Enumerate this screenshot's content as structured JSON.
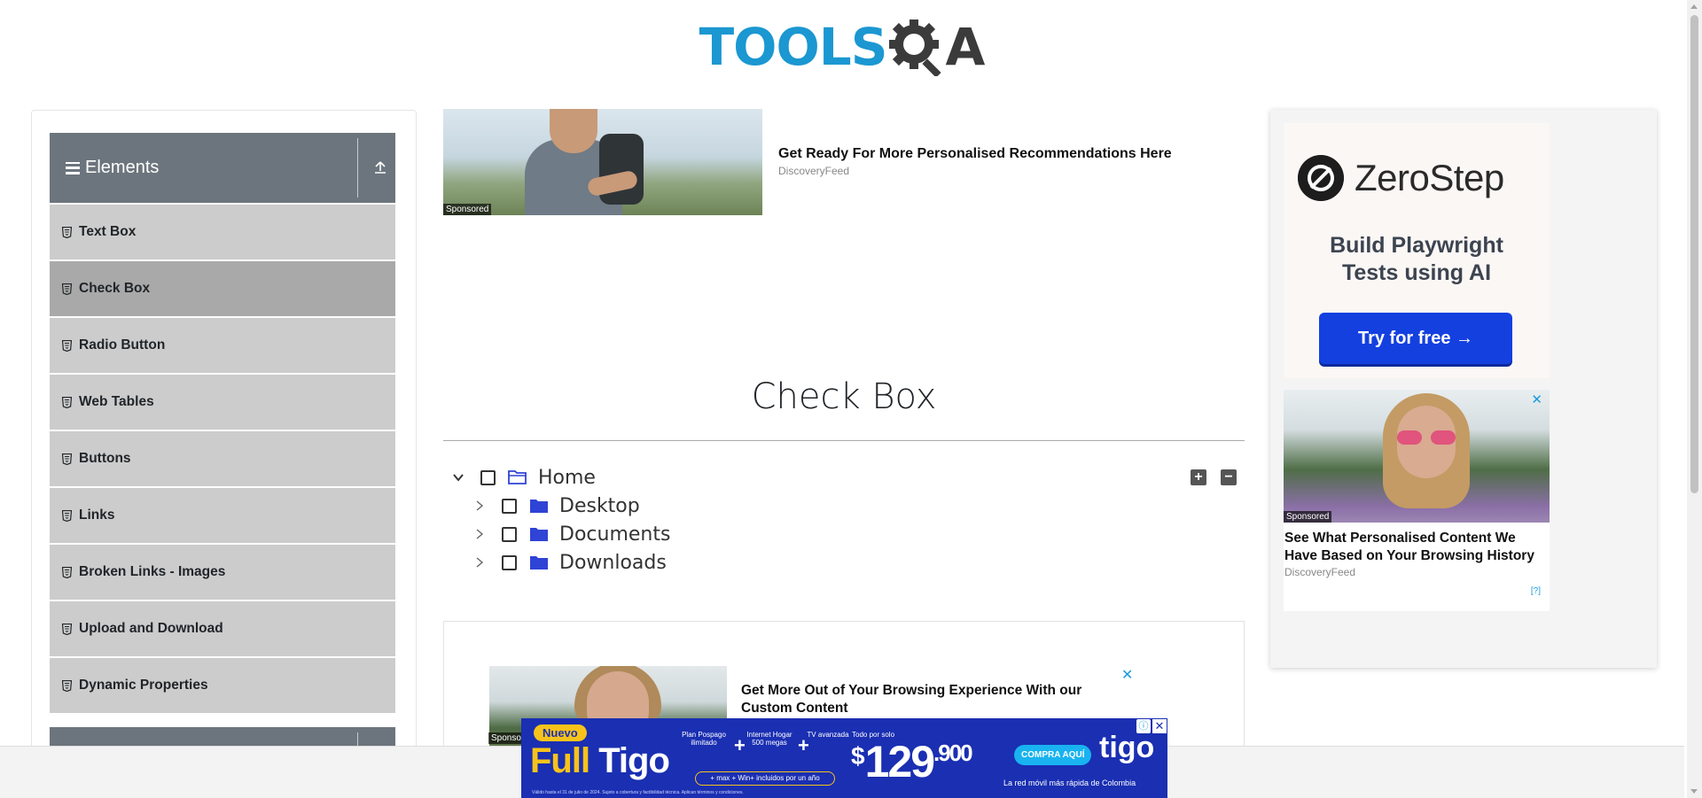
{
  "header": {
    "logo_text": "TOOLS",
    "logo_suffix": "A"
  },
  "sidebar": {
    "group_title": "Elements",
    "items": [
      {
        "label": "Text Box",
        "active": false
      },
      {
        "label": "Check Box",
        "active": true
      },
      {
        "label": "Radio Button",
        "active": false
      },
      {
        "label": "Web Tables",
        "active": false
      },
      {
        "label": "Buttons",
        "active": false
      },
      {
        "label": "Links",
        "active": false
      },
      {
        "label": "Broken Links - Images",
        "active": false
      },
      {
        "label": "Upload and Download",
        "active": false
      },
      {
        "label": "Dynamic Properties",
        "active": false
      }
    ]
  },
  "top_ad": {
    "sponsored": "Sponsored",
    "title": "Get Ready For More Personalised Recommendations Here",
    "source": "DiscoveryFeed"
  },
  "main": {
    "title": "Check Box",
    "tree": [
      {
        "label": "Home",
        "expanded": true,
        "level": 0
      },
      {
        "label": "Desktop",
        "expanded": false,
        "level": 1
      },
      {
        "label": "Documents",
        "expanded": false,
        "level": 1
      },
      {
        "label": "Downloads",
        "expanded": false,
        "level": 1
      }
    ],
    "expand_all": "+",
    "collapse_all": "−"
  },
  "mid_ad": {
    "title": "Get More Out of Your Browsing Experience With our Custom Content",
    "close": "✕",
    "sponsored": "Sponsored"
  },
  "right_ad": {
    "brand": "ZeroStep",
    "tagline_line1": "Build Playwright",
    "tagline_line2": "Tests using AI",
    "cta": "Try for free →",
    "card_sponsored": "Sponsored",
    "card_title": "See What Personalised Content We Have Based on Your Browsing History",
    "card_source": "DiscoveryFeed",
    "card_info": "[?]",
    "card_close": "✕"
  },
  "bottom_ad": {
    "nuevo": "Nuevo",
    "full": "Full",
    "brand_word": "Tigo",
    "feat1": "Plan Pospago ilimitado",
    "feat2": "Internet Hogar 500 megas",
    "feat3": "TV avanzada",
    "pill": "+ max + Win+ incluidos por un año",
    "price_label": "Todo por solo",
    "currency": "$",
    "price": "129",
    "price_dec": ".900",
    "cta": "COMPRA AQUÍ",
    "brand": "tigo",
    "tagline": "La red móvil más rápida de Colombia",
    "legal": "Válido hasta el 31 de julio de 2024. Sujeto a cobertura y factibilidad técnica. Aplican términos y condiciones.",
    "close": "✕",
    "info": "ⓘ"
  }
}
